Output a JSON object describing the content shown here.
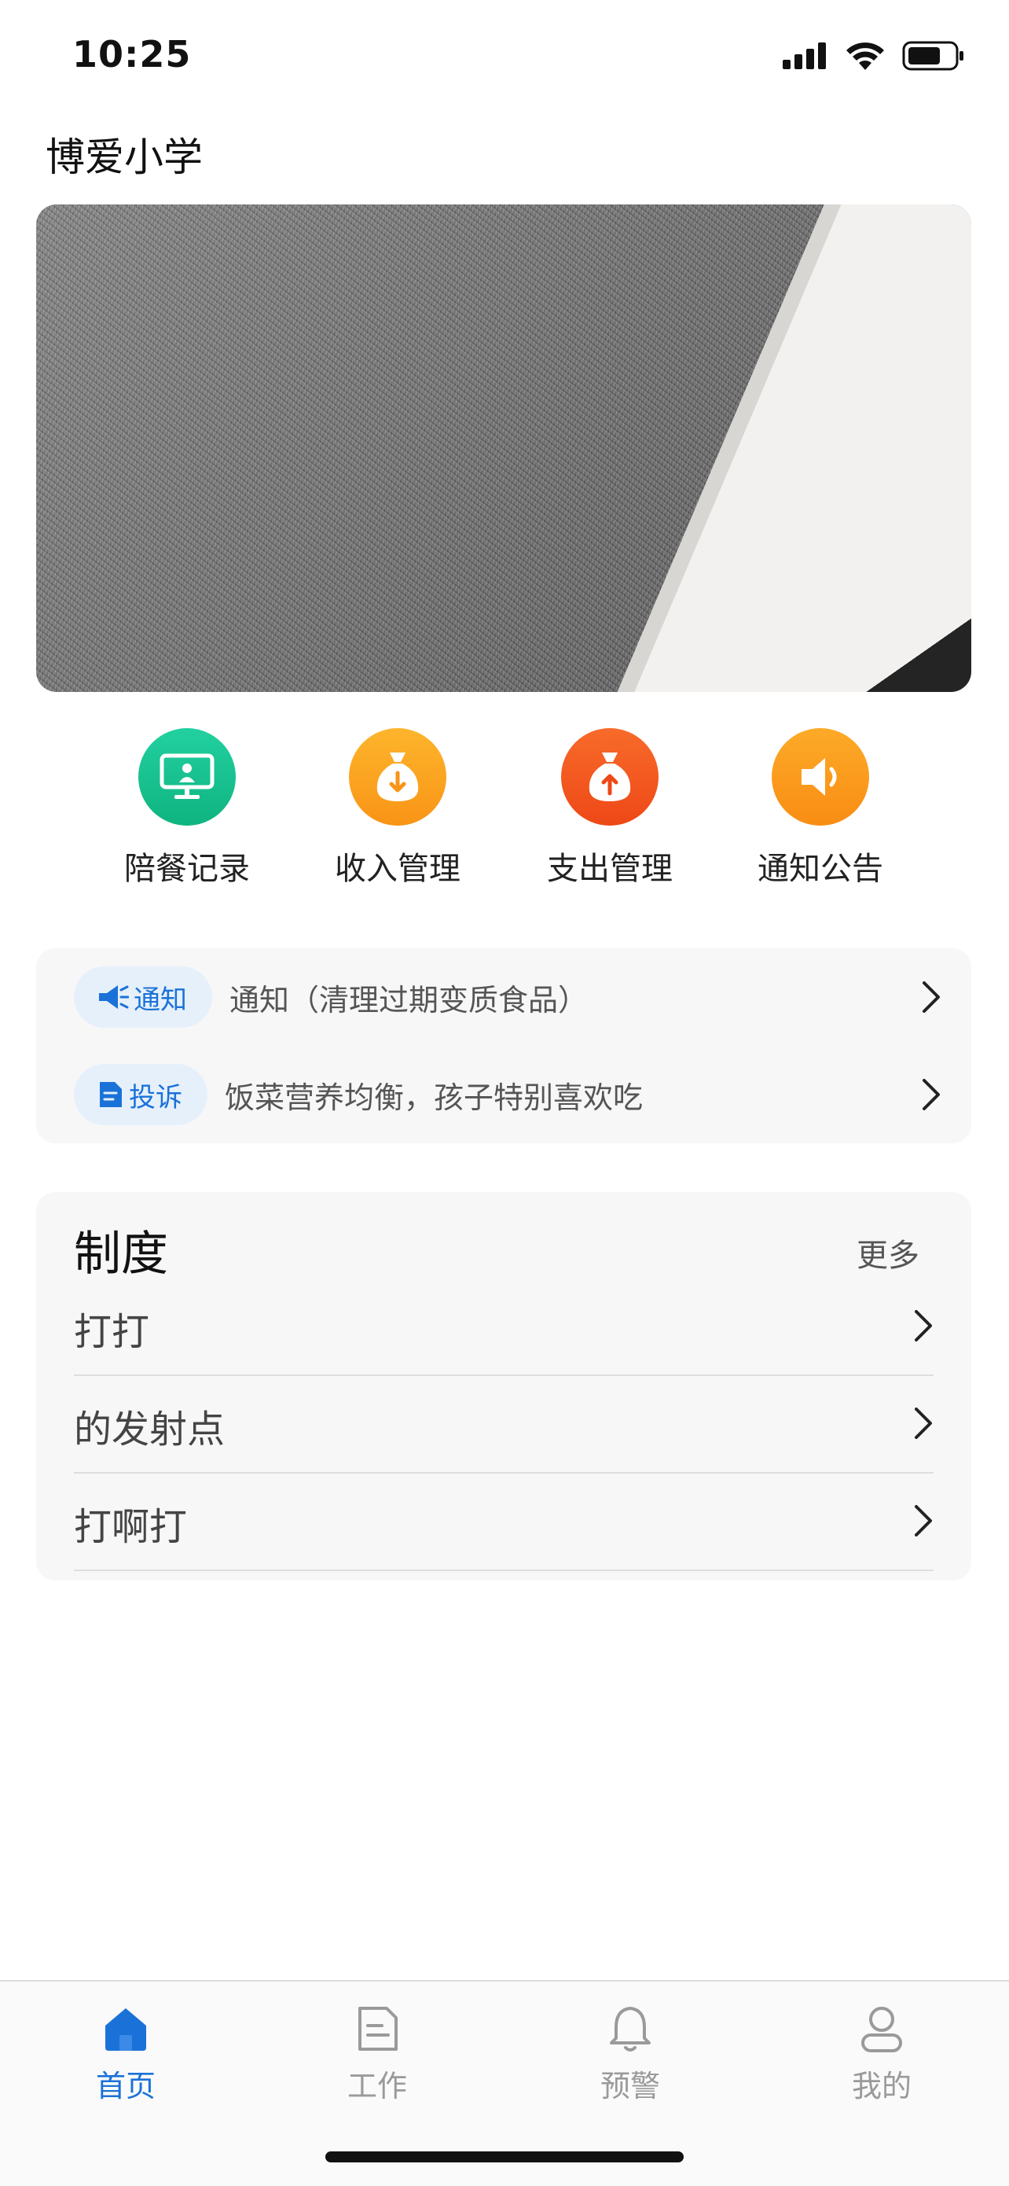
{
  "status_bar": {
    "time": "10:25"
  },
  "header": {
    "title": "博爱小学"
  },
  "quick_actions": [
    {
      "label": "陪餐记录",
      "icon": "monitor-icon",
      "color": "#14c08e"
    },
    {
      "label": "收入管理",
      "icon": "money-bag-down-icon",
      "color": "#fba21e"
    },
    {
      "label": "支出管理",
      "icon": "money-bag-up-icon",
      "color": "#f2561e"
    },
    {
      "label": "通知公告",
      "icon": "speaker-icon",
      "color": "#fb981c"
    }
  ],
  "notices": [
    {
      "badge": "通知",
      "icon": "megaphone-icon",
      "text": "通知（清理过期变质食品）"
    },
    {
      "badge": "投诉",
      "icon": "document-icon",
      "text": "饭菜营养均衡，孩子特别喜欢吃"
    }
  ],
  "rules": {
    "title": "制度",
    "more": "更多",
    "items": [
      {
        "label": "打打"
      },
      {
        "label": "的发射点"
      },
      {
        "label": "打啊打"
      }
    ]
  },
  "tabs": [
    {
      "label": "首页",
      "icon": "home-icon",
      "active": true
    },
    {
      "label": "工作",
      "icon": "work-doc-icon",
      "active": false
    },
    {
      "label": "预警",
      "icon": "bell-icon",
      "active": false
    },
    {
      "label": "我的",
      "icon": "user-icon",
      "active": false
    }
  ],
  "colors": {
    "accent": "#1a72d8",
    "inactive_tab": "#9a9a9a"
  }
}
